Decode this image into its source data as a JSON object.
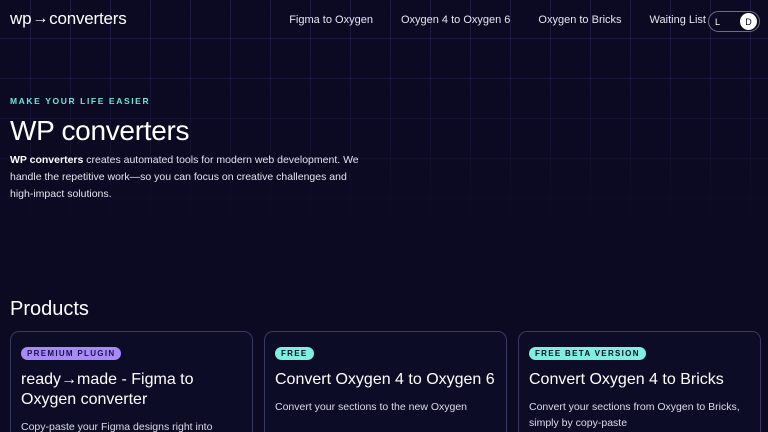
{
  "brand": {
    "logo_left": "wp",
    "logo_arrow": "→",
    "logo_right": "converters"
  },
  "nav": {
    "items": [
      {
        "label": "Figma to Oxygen"
      },
      {
        "label": "Oxygen 4 to Oxygen 6"
      },
      {
        "label": "Oxygen to Bricks"
      },
      {
        "label": "Waiting List"
      }
    ]
  },
  "theme_toggle": {
    "light": "L",
    "dark": "D",
    "selected": "D"
  },
  "hero": {
    "eyebrow": "MAKE YOUR LIFE EASIER",
    "title": "WP converters",
    "description_strong": "WP converters",
    "description_rest": " creates automated tools for modern web development. We handle the repetitive work—so you can focus on creative challenges and high-impact solutions."
  },
  "products": {
    "title": "Products",
    "cards": [
      {
        "badge": "PREMIUM PLUGIN",
        "badge_color": "#a78bfa",
        "title": "ready→made - Figma to Oxygen converter",
        "description": "Copy-paste your Figma designs right into"
      },
      {
        "badge": "FREE",
        "badge_color": "#7ff0df",
        "title": "Convert Oxygen 4 to Oxygen 6",
        "description": "Convert your sections to the new Oxygen"
      },
      {
        "badge": "FREE BETA VERSION",
        "badge_color": "#7ff0df",
        "title": "Convert Oxygen 4 to Bricks",
        "description": "Convert your sections from Oxygen to Bricks, simply by copy-paste"
      }
    ]
  },
  "colors": {
    "background": "#0b0a22",
    "accent_teal": "#6fe6d6",
    "accent_purple": "#a78bfa"
  }
}
